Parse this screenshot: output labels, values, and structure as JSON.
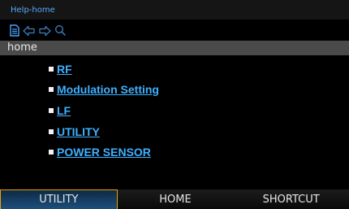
{
  "window": {
    "title": "Help-home"
  },
  "toolbar": {
    "icons": [
      "document-icon",
      "back-arrow-icon",
      "forward-arrow-icon",
      "search-icon"
    ]
  },
  "path": {
    "label": "home"
  },
  "links": [
    {
      "label": "RF"
    },
    {
      "label": "Modulation Setting"
    },
    {
      "label": "LF"
    },
    {
      "label": "UTILITY"
    },
    {
      "label": "POWER SENSOR"
    }
  ],
  "softkeys": [
    {
      "label": "UTILITY",
      "active": true
    },
    {
      "label": "HOME",
      "active": false
    },
    {
      "label": "SHORTCUT",
      "active": false
    }
  ],
  "colors": {
    "link": "#3fb0ff",
    "title": "#5aa9ff",
    "active_border": "#f0a000",
    "path_bar": "#4a4a4a"
  }
}
